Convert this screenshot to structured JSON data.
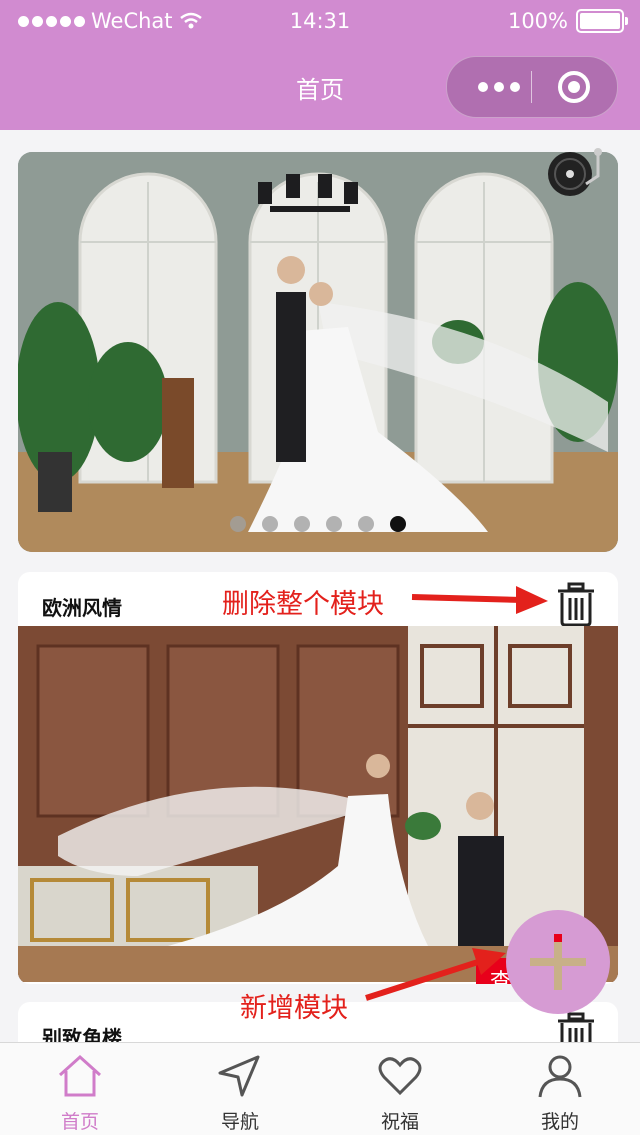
{
  "status_bar": {
    "carrier": "WeChat",
    "time": "14:31",
    "battery": "100%",
    "battery_level": 1.0
  },
  "nav": {
    "title": "首页"
  },
  "banner": {
    "slide_count": 6,
    "active_index": 5
  },
  "modules": [
    {
      "title": "欧洲风情",
      "button_label": "查看"
    },
    {
      "title": "别致角楼"
    }
  ],
  "annotations": {
    "delete_module": "删除整个模块",
    "add_module": "新增模块"
  },
  "tabbar": {
    "items": [
      {
        "label": "首页",
        "icon": "home-icon",
        "active": true
      },
      {
        "label": "导航",
        "icon": "navigation-icon",
        "active": false
      },
      {
        "label": "祝福",
        "icon": "heart-icon",
        "active": false
      },
      {
        "label": "我的",
        "icon": "user-icon",
        "active": false
      }
    ]
  },
  "colors": {
    "theme": "#d18bd0",
    "active_tab": "#d07cc9",
    "annotation": "#e3211c",
    "view_button": "#e8001a",
    "fab": "#d69bd3"
  }
}
